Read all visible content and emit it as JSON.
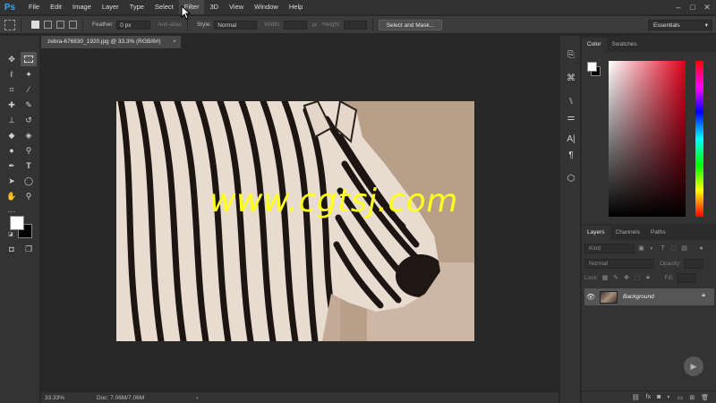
{
  "app": {
    "logo": "Ps",
    "menu": [
      "File",
      "Edit",
      "Image",
      "Layer",
      "Type",
      "Select",
      "Filter",
      "3D",
      "View",
      "Window",
      "Help"
    ],
    "active_menu": "Filter",
    "window_controls": [
      "–",
      "□",
      "✕"
    ]
  },
  "options": {
    "feather_label": "Feather:",
    "feather_value": "0 px",
    "antialias_label": "Anti-alias",
    "style_label": "Style:",
    "style_value": "Normal",
    "width_label": "Width:",
    "height_label": "Height:",
    "select_mask_label": "Select and Mask...",
    "workspace": "Essentials"
  },
  "document": {
    "tab_title": "zebra-676830_1920.jpg @ 33.3% (RGB/8#)",
    "close_glyph": "×",
    "watermark": "www.cgtsj.com"
  },
  "status": {
    "zoom": "33.33%",
    "doc_size": "Doc: 7.06M/7.06M",
    "arrow": "›"
  },
  "color_panel": {
    "tabs": [
      "Color",
      "Swatches"
    ],
    "active_tab": "Color",
    "foreground": "#ffffff",
    "background": "#000000",
    "hue_color": "#e0001b"
  },
  "layers_panel": {
    "tabs": [
      "Layers",
      "Channels",
      "Paths"
    ],
    "active_tab": "Layers",
    "filter_kind": "Kind",
    "blend_mode": "Normal",
    "opacity_label": "Opacity:",
    "lock_label": "Lock:",
    "fill_label": "Fill:",
    "layers": [
      {
        "name": "Background",
        "visible": true,
        "locked": true
      }
    ]
  },
  "icons": {
    "tools": [
      "move-icon",
      "marquee-icon",
      "lasso-icon",
      "magic-wand-icon",
      "crop-icon",
      "eyedropper-icon",
      "healing-brush-icon",
      "brush-icon",
      "clone-stamp-icon",
      "history-brush-icon",
      "eraser-icon",
      "paint-bucket-icon",
      "blur-icon",
      "dodge-icon",
      "pen-icon",
      "type-icon",
      "path-selection-icon",
      "ellipse-icon",
      "hand-icon",
      "zoom-icon"
    ]
  }
}
